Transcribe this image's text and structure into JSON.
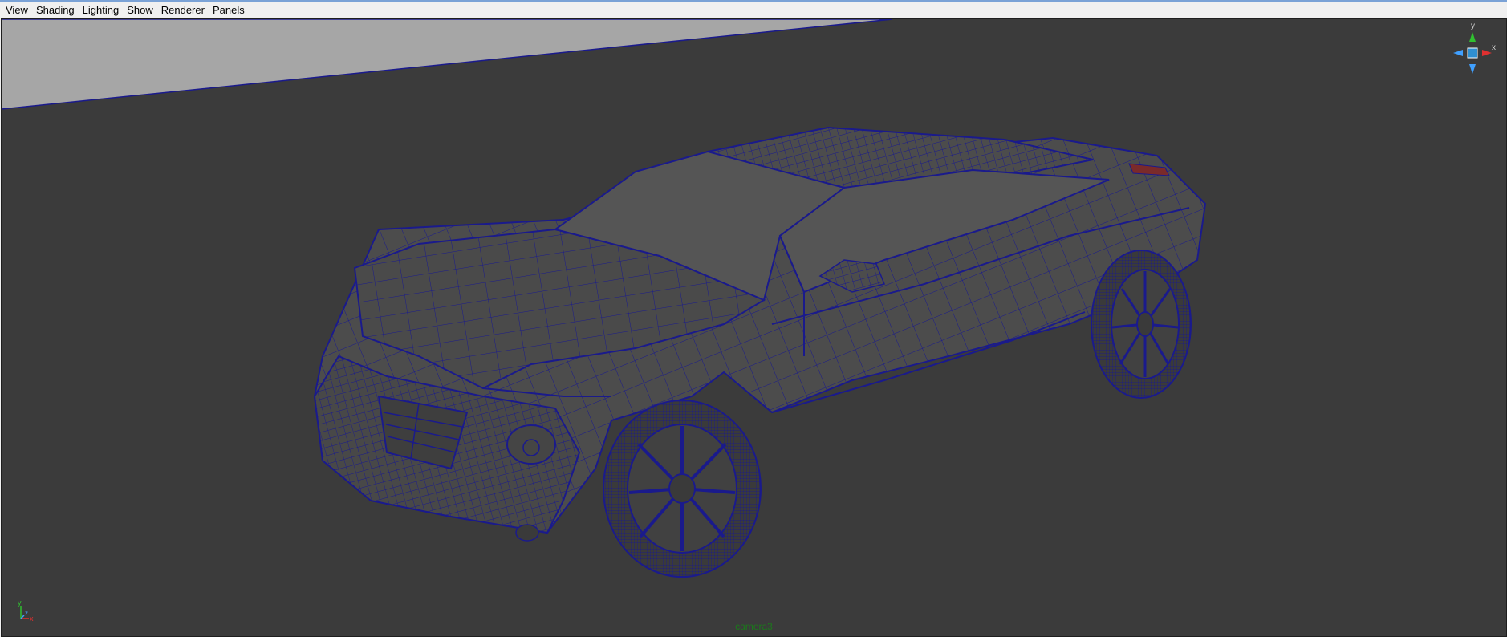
{
  "menubar": {
    "items": [
      {
        "label": "View"
      },
      {
        "label": "Shading"
      },
      {
        "label": "Lighting"
      },
      {
        "label": "Show"
      },
      {
        "label": "Renderer"
      },
      {
        "label": "Panels"
      }
    ]
  },
  "viewport": {
    "camera_name": "camera3",
    "view_cube": {
      "y_label": "y",
      "x_label": "x",
      "icon": "view-cube-icon"
    },
    "origin_axis": {
      "y_label": "y",
      "x_label": "x",
      "z_label": "z",
      "icon": "axis-indicator-icon"
    }
  },
  "colors": {
    "viewport_bg": "#3b3b3b",
    "ground_plane": "#a6a6a6",
    "wireframe": "#1a1a8c",
    "body_fill": "#4c4c4c",
    "glass_fill": "#555555",
    "camera_label": "#1a7a1a",
    "axis_x": "#e03030",
    "axis_y": "#30c030",
    "axis_z": "#40a0ff"
  }
}
